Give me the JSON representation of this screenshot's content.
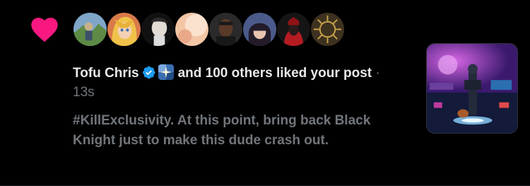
{
  "notification": {
    "type_icon": "heart-icon",
    "colors": {
      "heart": "#f91880",
      "verified": "#1d9bf0",
      "muted_text": "#71767b",
      "primary_text": "#e7e9ea",
      "background": "#000000"
    },
    "avatars": [
      {
        "icon": "avatar-1"
      },
      {
        "icon": "avatar-2"
      },
      {
        "icon": "avatar-3"
      },
      {
        "icon": "avatar-4"
      },
      {
        "icon": "avatar-5"
      },
      {
        "icon": "avatar-6"
      },
      {
        "icon": "avatar-7"
      },
      {
        "icon": "avatar-8"
      }
    ],
    "actor_name": "Tofu Chris",
    "actor_badge": "verified-badge-icon",
    "actor_flair": "flair-icon",
    "others_text": "and 100 others liked your post",
    "time_separator": "·",
    "time": "13s",
    "post_text": "#KillExclusivity. At this point, bring back Black Knight just to make this dude crash out."
  }
}
